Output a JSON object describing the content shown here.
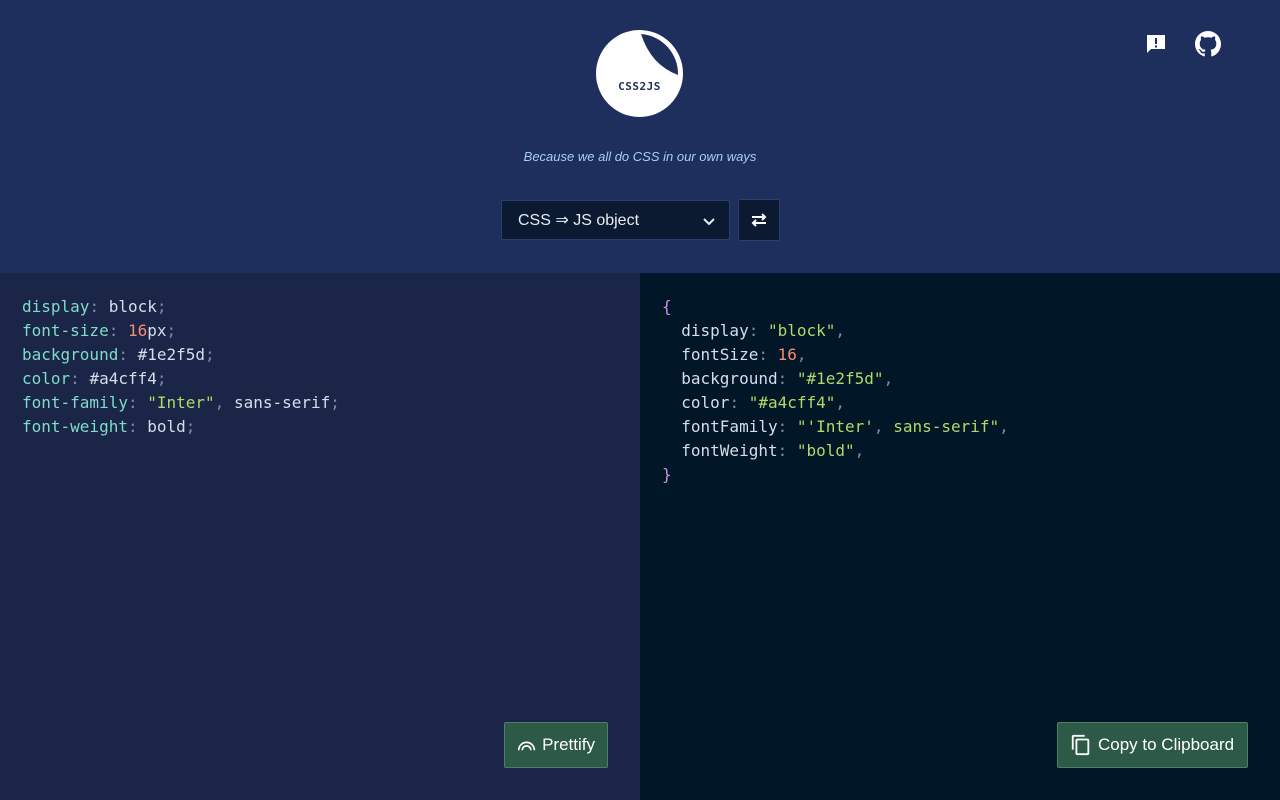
{
  "header": {
    "logo_text": "CSS2JS",
    "tagline": "Because we all do CSS in our own ways",
    "mode_select_value": "CSS ⇒ JS object",
    "icons": [
      "feedback-icon",
      "github-icon"
    ]
  },
  "input_code": [
    [
      {
        "t": "display",
        "c": "prop"
      },
      {
        "t": ": ",
        "c": "punc"
      },
      {
        "t": "block",
        "c": "val"
      },
      {
        "t": ";",
        "c": "punc"
      }
    ],
    [
      {
        "t": "font-size",
        "c": "prop"
      },
      {
        "t": ": ",
        "c": "punc"
      },
      {
        "t": "16",
        "c": "num"
      },
      {
        "t": "px",
        "c": "val"
      },
      {
        "t": ";",
        "c": "punc"
      }
    ],
    [
      {
        "t": "background",
        "c": "prop"
      },
      {
        "t": ": ",
        "c": "punc"
      },
      {
        "t": "#1e2f5d",
        "c": "val"
      },
      {
        "t": ";",
        "c": "punc"
      }
    ],
    [
      {
        "t": "color",
        "c": "prop"
      },
      {
        "t": ": ",
        "c": "punc"
      },
      {
        "t": "#a4cff4",
        "c": "val"
      },
      {
        "t": ";",
        "c": "punc"
      }
    ],
    [
      {
        "t": "font-family",
        "c": "prop"
      },
      {
        "t": ": ",
        "c": "punc"
      },
      {
        "t": "\"Inter\"",
        "c": "str"
      },
      {
        "t": ", ",
        "c": "punc"
      },
      {
        "t": "sans-serif",
        "c": "val"
      },
      {
        "t": ";",
        "c": "punc"
      }
    ],
    [
      {
        "t": "font-weight",
        "c": "prop"
      },
      {
        "t": ": ",
        "c": "punc"
      },
      {
        "t": "bold",
        "c": "val"
      },
      {
        "t": ";",
        "c": "punc"
      }
    ]
  ],
  "output_code": [
    [
      {
        "t": "{",
        "c": "brace"
      }
    ],
    [
      {
        "t": "  display",
        "c": "key"
      },
      {
        "t": ": ",
        "c": "punc"
      },
      {
        "t": "\"block\"",
        "c": "str"
      },
      {
        "t": ",",
        "c": "punc"
      }
    ],
    [
      {
        "t": "  fontSize",
        "c": "key"
      },
      {
        "t": ": ",
        "c": "punc"
      },
      {
        "t": "16",
        "c": "num"
      },
      {
        "t": ",",
        "c": "punc"
      }
    ],
    [
      {
        "t": "  background",
        "c": "key"
      },
      {
        "t": ": ",
        "c": "punc"
      },
      {
        "t": "\"#1e2f5d\"",
        "c": "str"
      },
      {
        "t": ",",
        "c": "punc"
      }
    ],
    [
      {
        "t": "  color",
        "c": "key"
      },
      {
        "t": ": ",
        "c": "punc"
      },
      {
        "t": "\"#a4cff4\"",
        "c": "str"
      },
      {
        "t": ",",
        "c": "punc"
      }
    ],
    [
      {
        "t": "  fontFamily",
        "c": "key"
      },
      {
        "t": ": ",
        "c": "punc"
      },
      {
        "t": "\"'Inter'",
        "c": "str"
      },
      {
        "t": ", ",
        "c": "punc"
      },
      {
        "t": "sans-serif\"",
        "c": "str"
      },
      {
        "t": ",",
        "c": "punc"
      }
    ],
    [
      {
        "t": "  fontWeight",
        "c": "key"
      },
      {
        "t": ": ",
        "c": "punc"
      },
      {
        "t": "\"bold\"",
        "c": "str"
      },
      {
        "t": ",",
        "c": "punc"
      }
    ],
    [
      {
        "t": "}",
        "c": "brace"
      }
    ]
  ],
  "buttons": {
    "prettify_label": "Prettify",
    "copy_label": "Copy to Clipboard"
  },
  "colors": {
    "header_bg": "#1e2f5d",
    "input_bg": "#1a2547",
    "output_bg": "#011627",
    "button_bg": "#2d5a47"
  }
}
